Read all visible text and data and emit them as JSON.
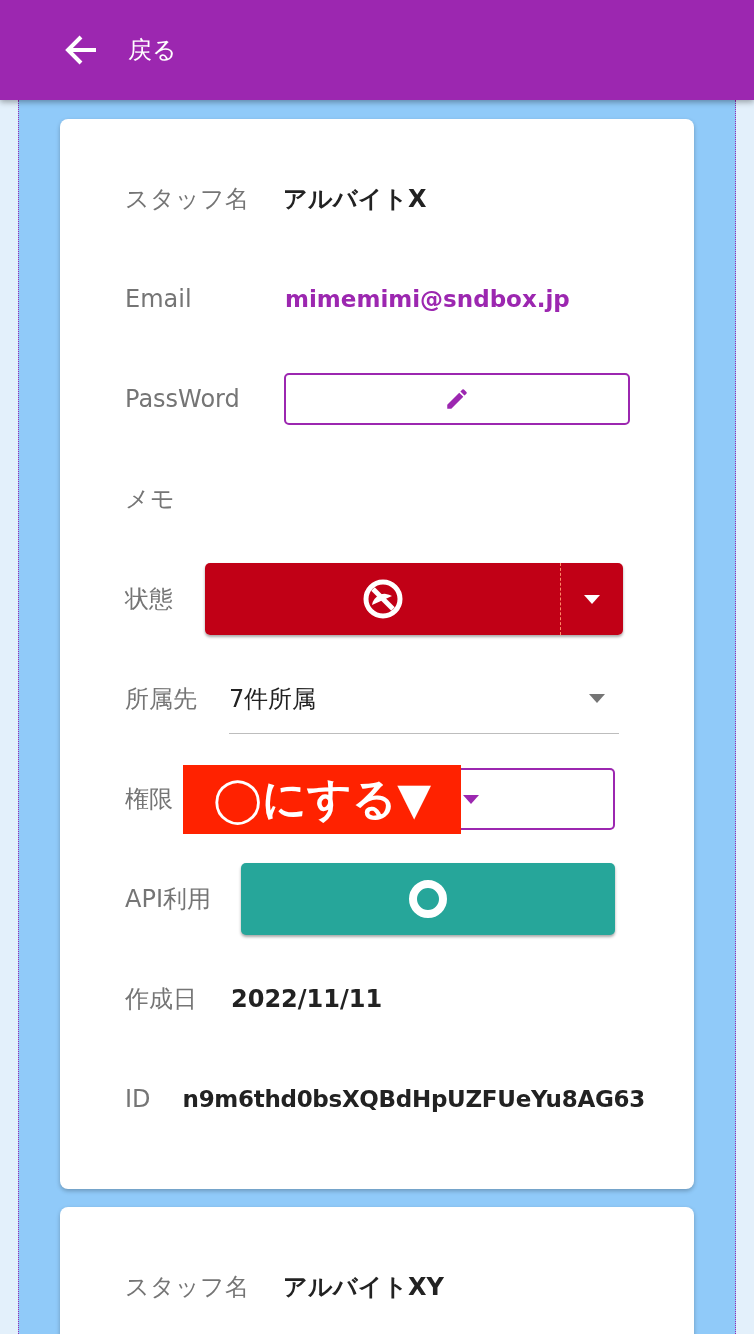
{
  "header": {
    "back_label": "戻る"
  },
  "cards": [
    {
      "fields": [
        {
          "kind": "text",
          "label": "スタッフ名",
          "value": "アルバイトX"
        },
        {
          "kind": "email",
          "label": "Email",
          "value": "mimemimi@sndbox.jp"
        },
        {
          "kind": "password",
          "label": "PassWord"
        },
        {
          "kind": "empty",
          "label": "メモ"
        },
        {
          "kind": "status",
          "label": "状態"
        },
        {
          "kind": "select",
          "label": "所属先",
          "value": "7件所属"
        },
        {
          "kind": "permission",
          "label": "権限",
          "annotation": "◯にする▼"
        },
        {
          "kind": "toggle",
          "label": "API利用"
        },
        {
          "kind": "text",
          "label": "作成日",
          "value": "2022/11/11"
        },
        {
          "kind": "id",
          "label": "ID",
          "value": "n9m6thd0bsXQBdHpUZFUeYu8AG63"
        }
      ]
    },
    {
      "fields": [
        {
          "kind": "text",
          "label": "スタッフ名",
          "value": "アルバイトXY"
        }
      ]
    }
  ]
}
